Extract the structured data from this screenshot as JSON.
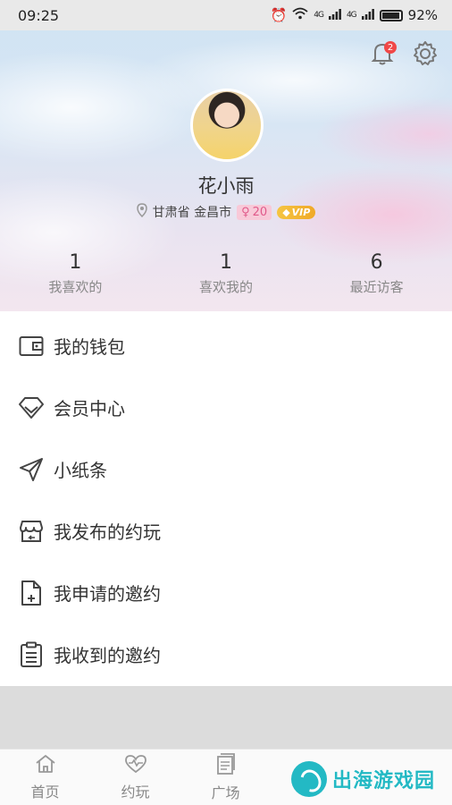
{
  "status_bar": {
    "time": "09:25",
    "battery": "92%",
    "signal_1": "4G",
    "signal_2": "4G"
  },
  "header": {
    "notification_count": "2"
  },
  "profile": {
    "nickname": "花小雨",
    "location": "甘肃省 金昌市",
    "age": "20",
    "vip_label": "VIP"
  },
  "stats": [
    {
      "value": "1",
      "label": "我喜欢的"
    },
    {
      "value": "1",
      "label": "喜欢我的"
    },
    {
      "value": "6",
      "label": "最近访客"
    }
  ],
  "menu": [
    {
      "label": "我的钱包",
      "icon": "wallet-icon"
    },
    {
      "label": "会员中心",
      "icon": "diamond-icon"
    },
    {
      "label": "小纸条",
      "icon": "send-icon"
    },
    {
      "label": "我发布的约玩",
      "icon": "store-icon"
    },
    {
      "label": "我申请的邀约",
      "icon": "file-add-icon"
    },
    {
      "label": "我收到的邀约",
      "icon": "clipboard-icon"
    }
  ],
  "tabs": [
    {
      "label": "首页",
      "icon": "home-icon"
    },
    {
      "label": "约玩",
      "icon": "heartbeat-icon"
    },
    {
      "label": "广场",
      "icon": "document-icon"
    }
  ],
  "watermark": {
    "text": "出海游戏园"
  },
  "colors": {
    "badge": "#f04848",
    "vip": "#f5c542",
    "gender_tag_bg": "#f8c9d8",
    "watermark": "#23b9c4"
  }
}
